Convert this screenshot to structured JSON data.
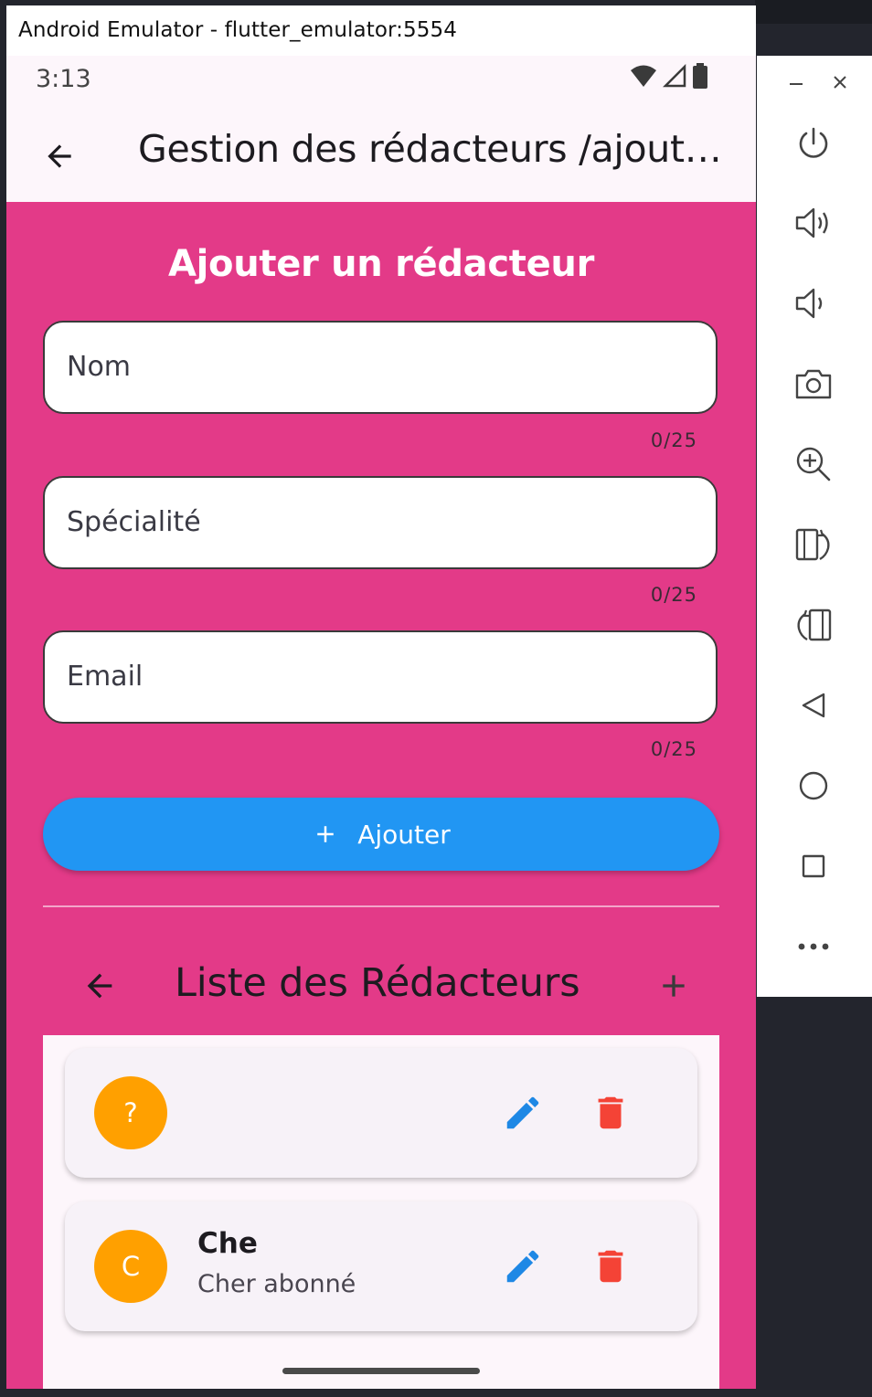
{
  "window": {
    "title": "Android Emulator - flutter_emulator:5554"
  },
  "status_bar": {
    "time": "3:13"
  },
  "app_bar": {
    "title": "Gestion des rédacteurs /ajouter..."
  },
  "form": {
    "title": "Ajouter un rédacteur",
    "fields": [
      {
        "placeholder": "Nom",
        "value": "",
        "counter": "0/25"
      },
      {
        "placeholder": "Spécialité",
        "value": "",
        "counter": "0/25"
      },
      {
        "placeholder": "Email",
        "value": "",
        "counter": "0/25"
      }
    ],
    "submit_label": "Ajouter"
  },
  "list": {
    "title": "Liste des Rédacteurs",
    "items": [
      {
        "avatar": "?",
        "name": "",
        "subtitle": ""
      },
      {
        "avatar": "C",
        "name": "Che",
        "subtitle": "Cher abonné"
      }
    ]
  },
  "emulator_toolbar": {
    "buttons": [
      "power-icon",
      "volume-up-icon",
      "volume-down-icon",
      "camera-icon",
      "zoom-in-icon",
      "rotate-right-icon",
      "rotate-left-icon",
      "back-icon",
      "home-icon",
      "overview-icon",
      "more-icon"
    ]
  },
  "colors": {
    "page_background": "#e33a88",
    "app_bar": "#fdf6fb",
    "primary_button": "#2196f3",
    "avatar": "#ffa000",
    "edit_icon": "#1e88e5",
    "delete_icon": "#f44336"
  }
}
